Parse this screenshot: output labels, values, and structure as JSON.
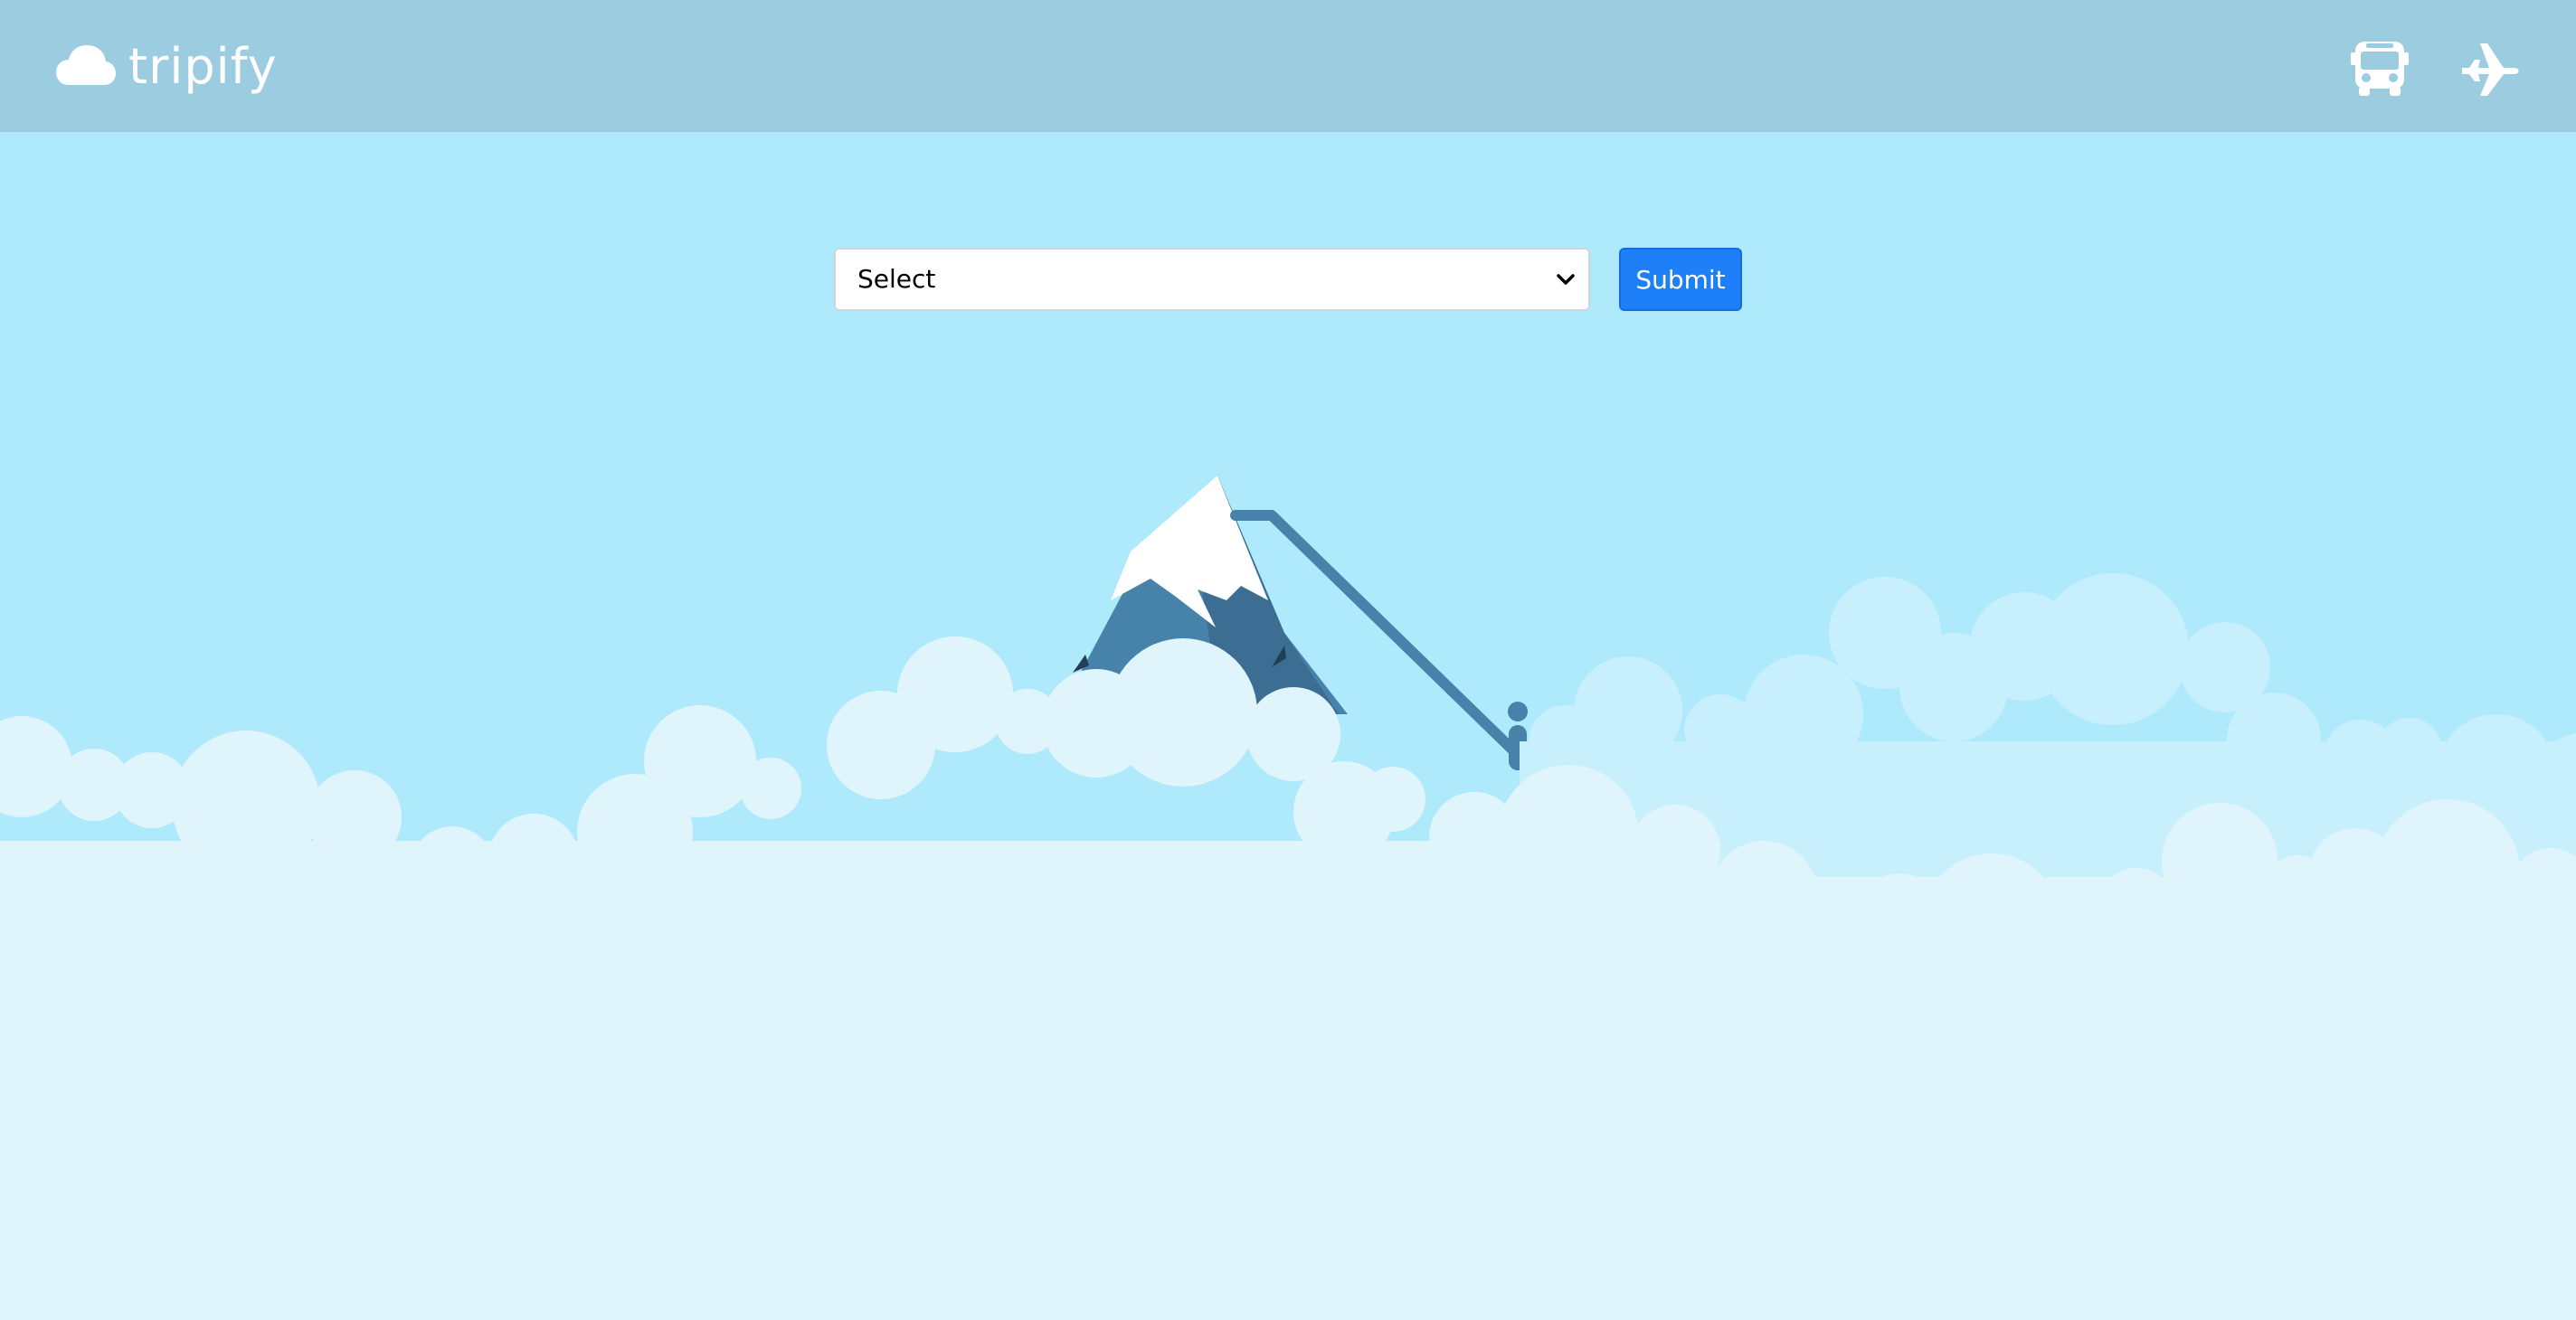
{
  "brand": {
    "name": "tripify",
    "icon": "cloud-icon"
  },
  "nav": {
    "icons": [
      "bus-icon",
      "plane-icon"
    ]
  },
  "form": {
    "select_value": "Select",
    "submit_label": "Submit"
  },
  "colors": {
    "navbar": "#9ccce0",
    "sky": "#aeeafc",
    "button": "#1e80f8",
    "mountain": "#4682aa",
    "mountain_dark": "#3a6a8c",
    "cloud_back": "#c8f0fc",
    "cloud_front": "#e0f5fb"
  }
}
